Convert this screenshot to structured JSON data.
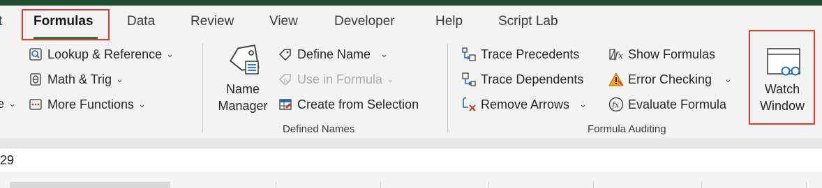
{
  "tabs": {
    "partial_left": "t",
    "formulas": "Formulas",
    "data": "Data",
    "review": "Review",
    "view": "View",
    "developer": "Developer",
    "help": "Help",
    "script_lab": "Script Lab"
  },
  "function_library": {
    "partial_left": "e",
    "lookup_reference": "Lookup & Reference",
    "math_trig": "Math & Trig",
    "more_functions": "More Functions"
  },
  "defined_names": {
    "name_manager_line1": "Name",
    "name_manager_line2": "Manager",
    "define_name": "Define Name",
    "use_in_formula": "Use in Formula",
    "create_from_selection": "Create from Selection",
    "group_label": "Defined Names"
  },
  "formula_auditing": {
    "trace_precedents": "Trace Precedents",
    "trace_dependents": "Trace Dependents",
    "remove_arrows": "Remove Arrows",
    "show_formulas": "Show Formulas",
    "error_checking": "Error Checking",
    "evaluate_formula": "Evaluate Formula",
    "group_label": "Formula Auditing",
    "watch_window_line1": "Watch",
    "watch_window_line2": "Window"
  },
  "formula_bar": {
    "value": "29"
  },
  "colors": {
    "accent": "#217346",
    "highlight": "#e53b2b",
    "title_bar": "#1e4e2f"
  }
}
